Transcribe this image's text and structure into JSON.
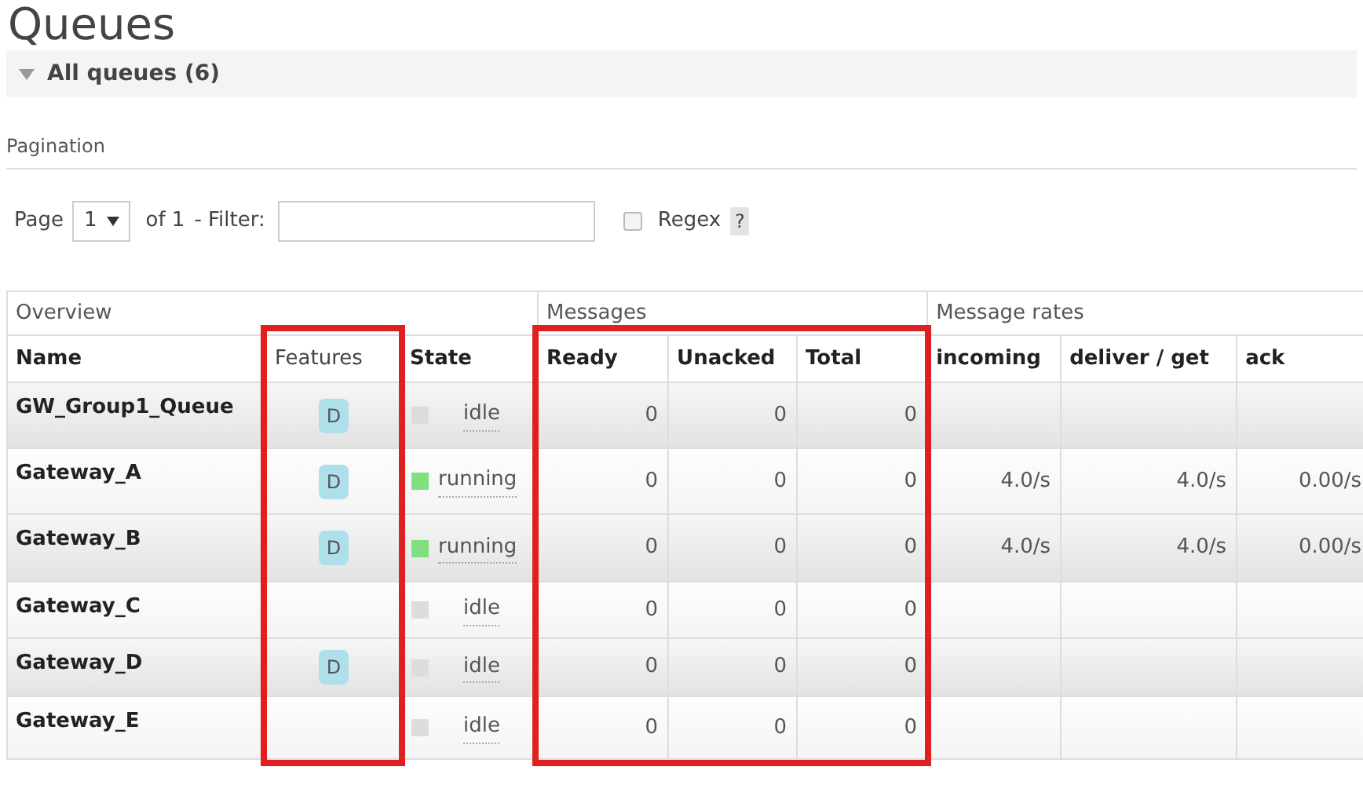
{
  "title": "Queues",
  "section": {
    "label": "All queues (6)",
    "expanded": true
  },
  "pagination": {
    "heading": "Pagination",
    "page_label": "Page",
    "page": "1",
    "of_label": "of 1",
    "filter_label": "- Filter:",
    "regex_label": "Regex",
    "regex_checked": false,
    "help": "?"
  },
  "column_groups": [
    {
      "label": "Overview"
    },
    {
      "label": "Messages"
    },
    {
      "label": "Message rates"
    }
  ],
  "columns": [
    {
      "label": "Name",
      "bold": true,
      "highlighted": false
    },
    {
      "label": "Features",
      "bold": false,
      "highlighted": true
    },
    {
      "label": "State",
      "bold": true,
      "highlighted": false
    },
    {
      "label": "Ready",
      "bold": true,
      "highlighted": true
    },
    {
      "label": "Unacked",
      "bold": true,
      "highlighted": true
    },
    {
      "label": "Total",
      "bold": true,
      "highlighted": true
    },
    {
      "label": "incoming",
      "bold": true,
      "highlighted": false
    },
    {
      "label": "deliver / get",
      "bold": true,
      "highlighted": false
    },
    {
      "label": "ack",
      "bold": true,
      "highlighted": false
    }
  ],
  "rows": [
    {
      "name": "GW_Group1_Queue",
      "features": [
        "D"
      ],
      "state": {
        "text": "idle",
        "kind": "idle"
      },
      "ready": "0",
      "unacked": "0",
      "total": "0",
      "rates": []
    },
    {
      "name": "Gateway_A",
      "features": [
        "D"
      ],
      "state": {
        "text": "running",
        "kind": "running"
      },
      "ready": "0",
      "unacked": "0",
      "total": "0",
      "rates": [
        "4.0/s",
        "4.0/s",
        "0.00/s"
      ]
    },
    {
      "name": "Gateway_B",
      "features": [
        "D"
      ],
      "state": {
        "text": "running",
        "kind": "running"
      },
      "ready": "0",
      "unacked": "0",
      "total": "0",
      "rates": [
        "4.0/s",
        "4.0/s",
        "0.00/s"
      ]
    },
    {
      "name": "Gateway_C",
      "features": [],
      "state": {
        "text": "idle",
        "kind": "idle"
      },
      "ready": "0",
      "unacked": "0",
      "total": "0",
      "rates": []
    },
    {
      "name": "Gateway_D",
      "features": [
        "D"
      ],
      "state": {
        "text": "idle",
        "kind": "idle"
      },
      "ready": "0",
      "unacked": "0",
      "total": "0",
      "rates": []
    },
    {
      "name": "Gateway_E",
      "features": [],
      "state": {
        "text": "idle",
        "kind": "idle"
      },
      "ready": "0",
      "unacked": "0",
      "total": "0",
      "rates": []
    }
  ]
}
